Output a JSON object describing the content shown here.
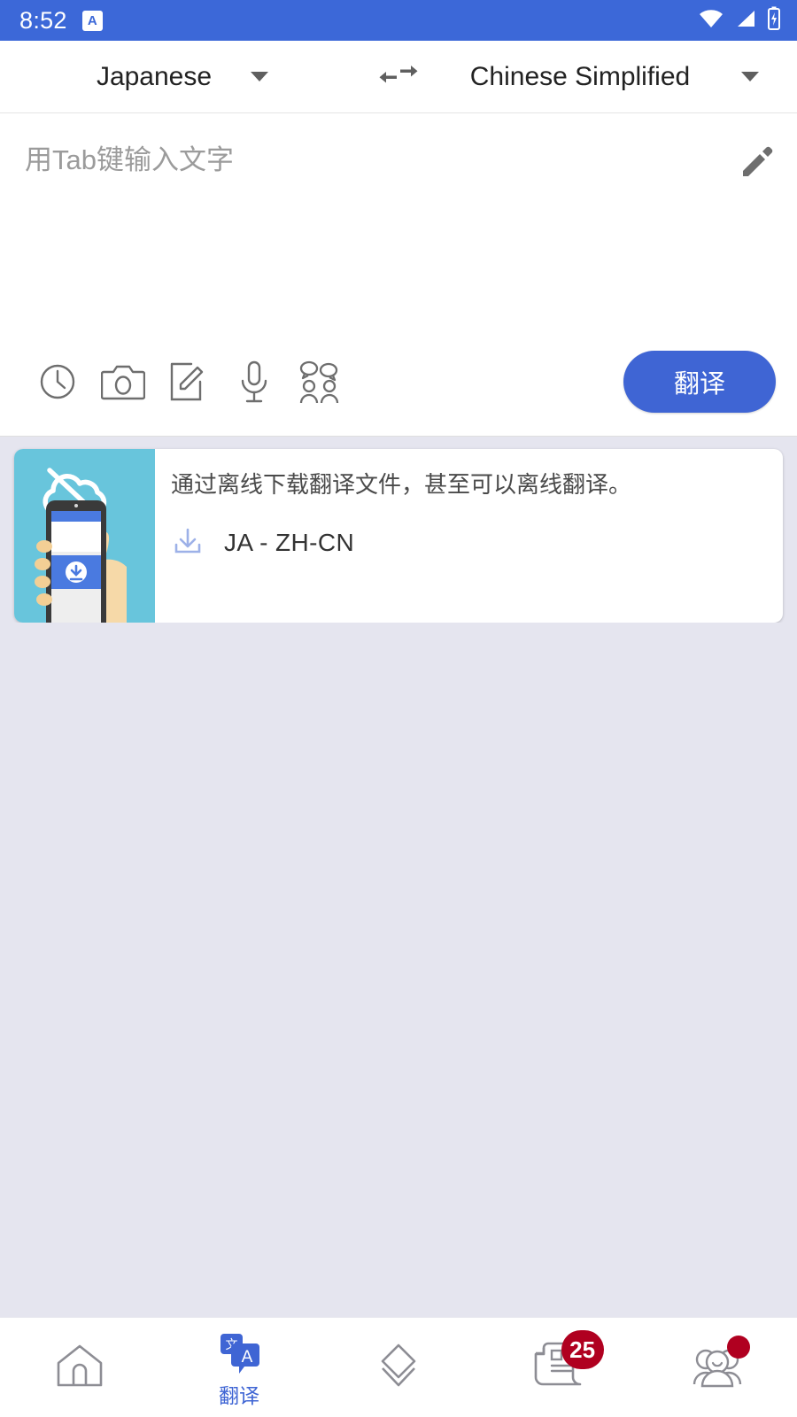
{
  "status_bar": {
    "time": "8:52",
    "app_badge_letter": "A",
    "icons": [
      "wifi-icon",
      "signal-icon",
      "battery-charging-icon"
    ],
    "background_color": "#3c68d8"
  },
  "language_bar": {
    "source_language": "Japanese",
    "target_language": "Chinese Simplified",
    "swap_icon": "swap-horizontal-icon",
    "source_caret": "chevron-down-icon",
    "target_caret": "chevron-down-icon"
  },
  "input_card": {
    "placeholder": "用Tab键输入文字",
    "edit_icon": "pencil-icon",
    "tools": [
      {
        "name": "history-icon",
        "label": "History"
      },
      {
        "name": "camera-icon",
        "label": "Camera"
      },
      {
        "name": "handwriting-icon",
        "label": "Handwriting"
      },
      {
        "name": "microphone-icon",
        "label": "Voice"
      },
      {
        "name": "conversation-icon",
        "label": "Conversation"
      }
    ],
    "translate_button_label": "翻译",
    "translate_button_color": "#3f65d4"
  },
  "promo_card": {
    "illustration": {
      "background_color": "#68c5dc",
      "cloud_off_icon": "cloud-off-icon",
      "phone_in_hand": "phone-download-illustration"
    },
    "message": "通过离线下载翻译文件，甚至可以离线翻译。",
    "download_icon": "download-icon",
    "download_label": "JA - ZH-CN"
  },
  "bottom_nav": {
    "items": [
      {
        "name": "home",
        "icon": "home-icon",
        "label": "",
        "active": false,
        "badge": ""
      },
      {
        "name": "translate",
        "icon": "translate-bubbles-icon",
        "label": "翻译",
        "active": true,
        "badge": ""
      },
      {
        "name": "layers",
        "icon": "diamond-layers-icon",
        "label": "",
        "active": false,
        "badge": ""
      },
      {
        "name": "news",
        "icon": "news-scroll-icon",
        "label": "",
        "active": false,
        "badge": "25"
      },
      {
        "name": "community",
        "icon": "people-group-icon",
        "label": "",
        "active": false,
        "badge": "dot"
      }
    ],
    "active_color": "#3f65d4",
    "badge_color": "#b00020"
  }
}
